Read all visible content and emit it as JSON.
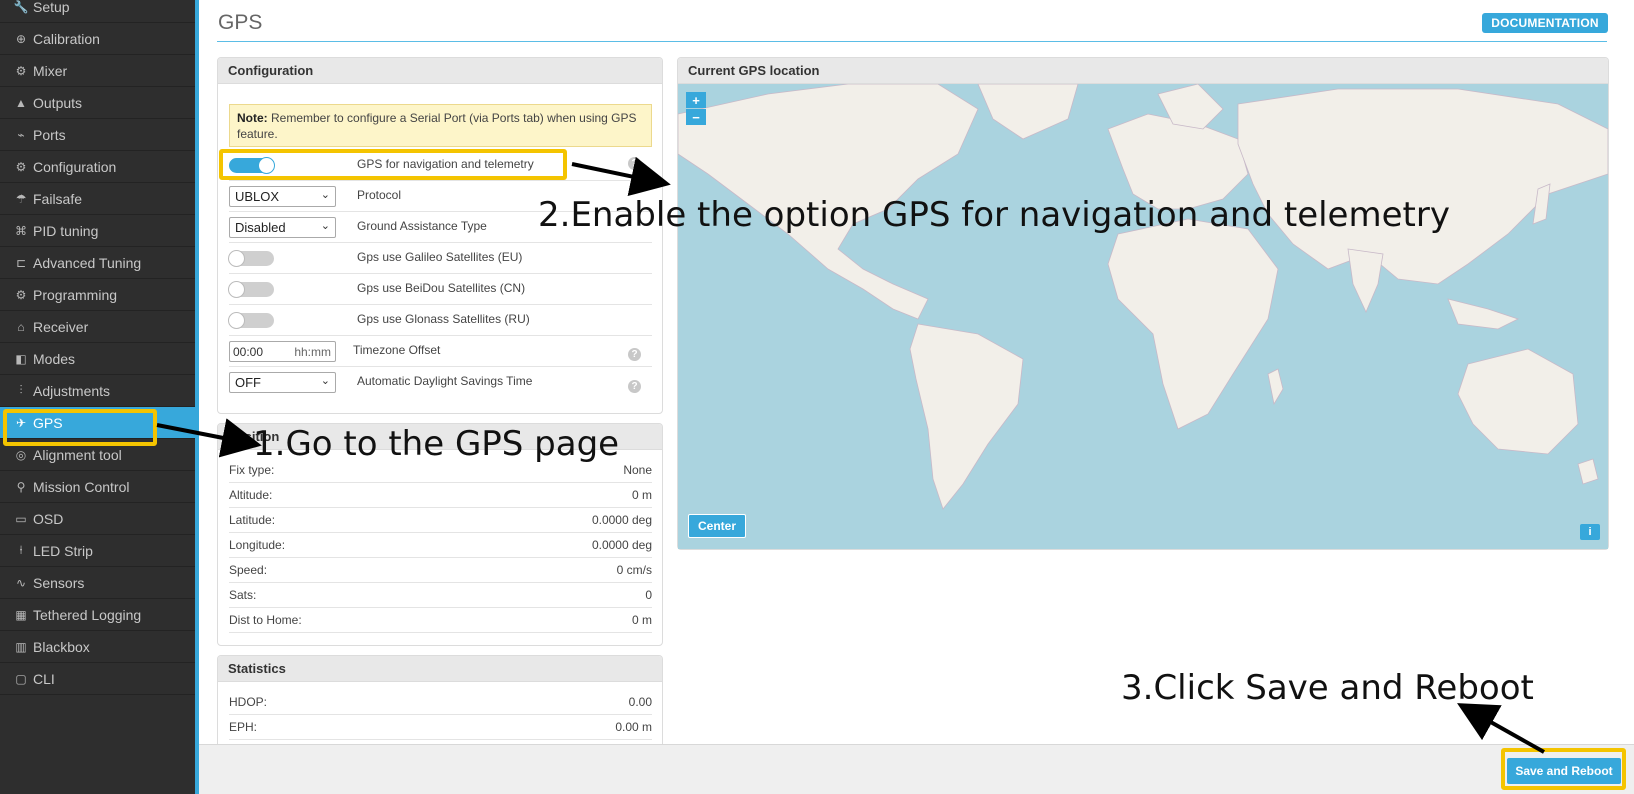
{
  "sidebar": {
    "items": [
      {
        "label": "Setup",
        "icon": "wrench-icon",
        "glyph": "🔧"
      },
      {
        "label": "Calibration",
        "icon": "crosshair-icon",
        "glyph": "⊕"
      },
      {
        "label": "Mixer",
        "icon": "mixer-icon",
        "glyph": "⚙"
      },
      {
        "label": "Outputs",
        "icon": "motor-icon",
        "glyph": "▲"
      },
      {
        "label": "Ports",
        "icon": "plug-icon",
        "glyph": "⌁"
      },
      {
        "label": "Configuration",
        "icon": "gear-icon",
        "glyph": "⚙"
      },
      {
        "label": "Failsafe",
        "icon": "parachute-icon",
        "glyph": "☂"
      },
      {
        "label": "PID tuning",
        "icon": "sitemap-icon",
        "glyph": "⌘"
      },
      {
        "label": "Advanced Tuning",
        "icon": "tree-icon",
        "glyph": "⊏"
      },
      {
        "label": "Programming",
        "icon": "gear-icon",
        "glyph": "⚙"
      },
      {
        "label": "Receiver",
        "icon": "robot-icon",
        "glyph": "⌂"
      },
      {
        "label": "Modes",
        "icon": "toggle-icon",
        "glyph": "◧"
      },
      {
        "label": "Adjustments",
        "icon": "sliders-icon",
        "glyph": "⫶"
      },
      {
        "label": "GPS",
        "icon": "satellite-icon",
        "glyph": "✈"
      },
      {
        "label": "Alignment tool",
        "icon": "compass-icon",
        "glyph": "◎"
      },
      {
        "label": "Mission Control",
        "icon": "map-marker-icon",
        "glyph": "⚲"
      },
      {
        "label": "OSD",
        "icon": "osd-icon",
        "glyph": "▭"
      },
      {
        "label": "LED Strip",
        "icon": "bulb-icon",
        "glyph": "⍿"
      },
      {
        "label": "Sensors",
        "icon": "pulse-icon",
        "glyph": "∿"
      },
      {
        "label": "Tethered Logging",
        "icon": "keyboard-icon",
        "glyph": "▦"
      },
      {
        "label": "Blackbox",
        "icon": "chip-icon",
        "glyph": "▥"
      },
      {
        "label": "CLI",
        "icon": "terminal-icon",
        "glyph": "▢"
      }
    ],
    "active_index": 13
  },
  "header": {
    "title": "GPS",
    "doc_label": "DOCUMENTATION"
  },
  "configuration": {
    "title": "Configuration",
    "note_bold": "Note:",
    "note_text": " Remember to configure a Serial Port (via Ports tab) when using GPS feature.",
    "gps_toggle_label": "GPS for navigation and telemetry",
    "gps_toggle_on": true,
    "protocol_value": "UBLOX",
    "protocol_label": "Protocol",
    "assist_value": "Disabled",
    "assist_label": "Ground Assistance Type",
    "galileo_label": "Gps use Galileo Satellites (EU)",
    "beidou_label": "Gps use BeiDou Satellites (CN)",
    "glonass_label": "Gps use Glonass Satellites (RU)",
    "tz_value": "00:00",
    "tz_unit": "hh:mm",
    "tz_label": "Timezone Offset",
    "dst_value": "OFF",
    "dst_label": "Automatic Daylight Savings Time",
    "help_glyph": "?"
  },
  "position": {
    "title": "Position",
    "rows": [
      {
        "k": "Fix type:",
        "v": "None"
      },
      {
        "k": "Altitude:",
        "v": "0 m"
      },
      {
        "k": "Latitude:",
        "v": "0.0000 deg"
      },
      {
        "k": "Longitude:",
        "v": "0.0000 deg"
      },
      {
        "k": "Speed:",
        "v": "0 cm/s"
      },
      {
        "k": "Sats:",
        "v": "0"
      },
      {
        "k": "Dist to Home:",
        "v": "0 m"
      }
    ]
  },
  "statistics": {
    "title": "Statistics",
    "rows": [
      {
        "k": "HDOP:",
        "v": "0.00"
      },
      {
        "k": "EPH:",
        "v": "0.00 m"
      }
    ]
  },
  "map": {
    "title": "Current GPS location",
    "zoom_in": "+",
    "zoom_out": "−",
    "center_label": "Center",
    "info_label": "i",
    "water_color": "#aad3df",
    "land_color": "#f2efe9"
  },
  "footer": {
    "save_label": "Save and Reboot"
  },
  "annotations": {
    "step1": "1.Go to the GPS page",
    "step2": "2.Enable the option GPS for navigation and telemetry",
    "step3": "3.Click Save and Reboot",
    "highlight_color": "#f4c400"
  }
}
